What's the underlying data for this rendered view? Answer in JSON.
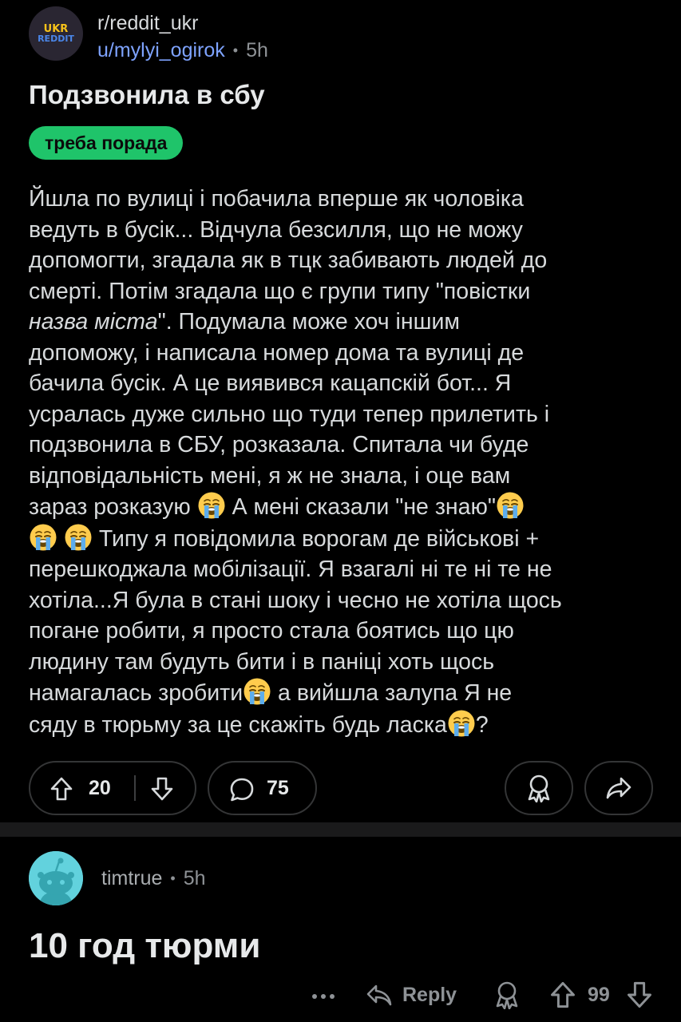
{
  "post": {
    "subreddit": "r/reddit_ukr",
    "avatar_line1": "UKR",
    "avatar_line2": "REDDIT",
    "author": "u/mylyi_ogirok",
    "separator": "•",
    "time": "5h",
    "title": "Подзвонила в сбу",
    "flair": "треба порада",
    "body_lines": [
      "Йшла по вулиці і побачила вперше як чоловіка",
      "ведуть в бусік... Відчула безсилля, що не можу",
      "допомогти, згадала як в тцк забивають людей до",
      "смерті. Потім згадала що є групи типу \"повістки",
      "\". Подумала може хоч іншим",
      "допоможу, і написала номер дома та вулиці де",
      "бачила бусік. А це виявився кацапскій бот... Я",
      "усралась дуже сильно що туди тепер прилетить і",
      "подзвонила в СБУ, розказала. Спитала чи буде",
      "відповідальність мені, я ж не знала, і оце вам",
      "зараз розказую ",
      " А мені сказали \"не знаю\"",
      " Типу я повідомила ворогам де військові +",
      "перешкоджала мобілізації. Я взагалі ні те ні те не",
      "хотіла...Я була в стані шоку і чесно не хотіла щось",
      "погане робити, я просто стала боятись що цю",
      "людину там будуть бити і в паніці хоть щось",
      "намагалась зробити",
      " а вийшла залупа Я не",
      "сяду в тюрьму за це скажіть будь ласка",
      "?"
    ],
    "body_italic": "назва міста",
    "emoji_name": "loudly-crying-face",
    "upvotes": "20",
    "comments": "75"
  },
  "comment": {
    "username": "timtrue",
    "separator": "•",
    "time": "5h",
    "text": "10 год тюрми",
    "more": "•••",
    "reply_label": "Reply",
    "score": "99"
  },
  "colors": {
    "background": "#000000",
    "divider": "#1a1a1b",
    "flair": "#1fc46a",
    "author_link": "#7ea3ff",
    "comment_avatar": "#62d2dd"
  }
}
